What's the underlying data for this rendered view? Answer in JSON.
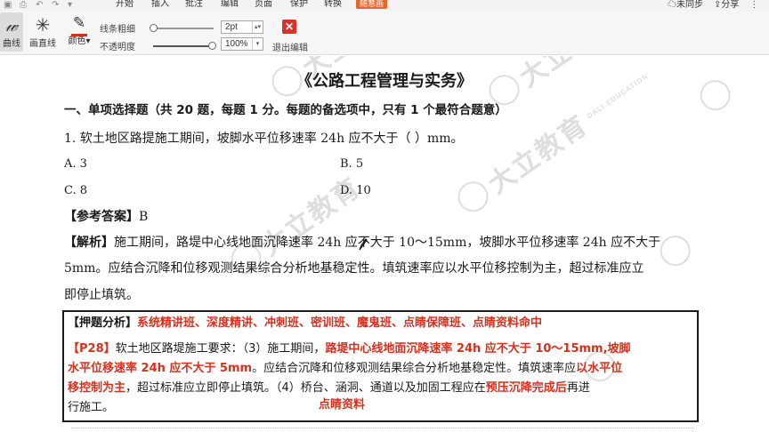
{
  "menu": {
    "items": [
      "开始",
      "插入",
      "批注",
      "编辑",
      "页面",
      "保护",
      "转换"
    ],
    "active": "随意画",
    "sync": "未同步",
    "share": "分享"
  },
  "toolbar": {
    "curve_label": "曲线",
    "line_label": "画直线",
    "color_label": "颜色",
    "thickness_label": "线条粗细",
    "opacity_label": "不透明度",
    "thickness_value": "2pt",
    "opacity_value": "100%",
    "exit_label": "退出编辑"
  },
  "watermark": {
    "text": "大立教育",
    "sub": "DALI EDUCATION"
  },
  "doc": {
    "title": "《公路工程管理与实务》",
    "section": "一、单项选择题（共 20 题，每题 1 分。每题的备选项中，只有 1 个最符合题意）",
    "question": "1. 软土地区路提施工期间，坡脚水平位移速率 24h 应不大于（    ）mm。",
    "options": {
      "a": "A. 3",
      "b": "B. 5",
      "c": "C. 8",
      "d": "D. 10"
    },
    "answer_label": "【参考答案】",
    "answer_value": "B",
    "analysis_label": "【解析】",
    "analysis_1": "施工期间，路堤中心线地面沉降速率 24h 应不大于 10～15mm，坡脚水平位移速率 24h 应不大于",
    "analysis_2": "5mm。应结合沉降和位移观测结果综合分析地基稳定性。填筑速率应以水平位移控制为主，超过标准应立",
    "analysis_3": "即停止填筑。",
    "box": {
      "label": "【押题分析】",
      "classes": "系统精讲班、深度精讲、冲刺班、密训班、魔鬼班、点睛保障班、点睛资料命中",
      "p28_label": "【P28】",
      "p28_a": "软土地区路堤施工要求：（3）施工期间，",
      "p28_red1": "路堤中心线地面沉降速率 24h 应不大于 10～15mm,坡脚",
      "p28_red2": "水平位移速率 24h 应不大于 5mm",
      "p28_b": "。应结合沉降和位移观测结果综合分析地基稳定性。填筑速率应",
      "p28_red3": "以水平位",
      "p28_red4": "移控制为主",
      "p28_c": "，超过标准应立即停止填筑。（4）桥台、涵洞、通道以及加固工程应在",
      "p28_red5": "预压沉降完成后",
      "p28_d": "再进",
      "p28_e": "行施工。",
      "stamp": "点睛资料"
    }
  }
}
